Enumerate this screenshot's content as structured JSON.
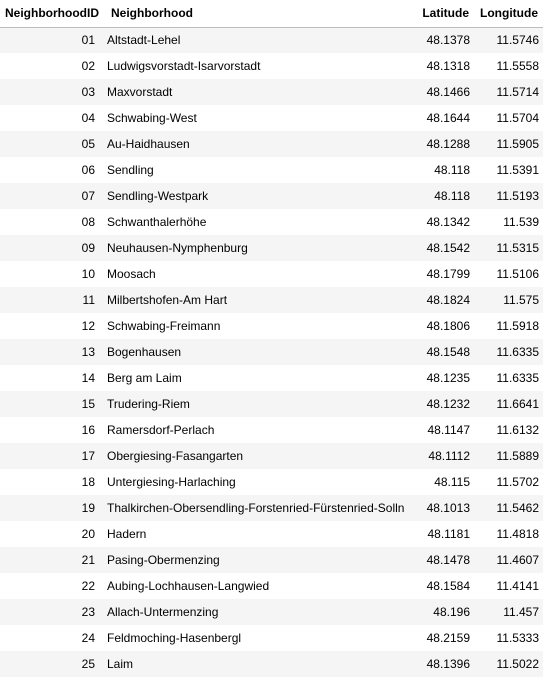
{
  "table": {
    "columns": [
      "NeighborhoodID",
      "Neighborhood",
      "Latitude",
      "Longitude"
    ],
    "rows": [
      [
        "01",
        "Altstadt-Lehel",
        "48.1378",
        "11.5746"
      ],
      [
        "02",
        "Ludwigsvorstadt-Isarvorstadt",
        "48.1318",
        "11.5558"
      ],
      [
        "03",
        "Maxvorstadt",
        "48.1466",
        "11.5714"
      ],
      [
        "04",
        "Schwabing-West",
        "48.1644",
        "11.5704"
      ],
      [
        "05",
        "Au-Haidhausen",
        "48.1288",
        "11.5905"
      ],
      [
        "06",
        "Sendling",
        "48.118",
        "11.5391"
      ],
      [
        "07",
        "Sendling-Westpark",
        "48.118",
        "11.5193"
      ],
      [
        "08",
        "Schwanthalerhöhe",
        "48.1342",
        "11.539"
      ],
      [
        "09",
        "Neuhausen-Nymphenburg",
        "48.1542",
        "11.5315"
      ],
      [
        "10",
        "Moosach",
        "48.1799",
        "11.5106"
      ],
      [
        "11",
        "Milbertshofen-Am Hart",
        "48.1824",
        "11.575"
      ],
      [
        "12",
        "Schwabing-Freimann",
        "48.1806",
        "11.5918"
      ],
      [
        "13",
        "Bogenhausen",
        "48.1548",
        "11.6335"
      ],
      [
        "14",
        "Berg am Laim",
        "48.1235",
        "11.6335"
      ],
      [
        "15",
        "Trudering-Riem",
        "48.1232",
        "11.6641"
      ],
      [
        "16",
        "Ramersdorf-Perlach",
        "48.1147",
        "11.6132"
      ],
      [
        "17",
        "Obergiesing-Fasangarten",
        "48.1112",
        "11.5889"
      ],
      [
        "18",
        "Untergiesing-Harlaching",
        "48.115",
        "11.5702"
      ],
      [
        "19",
        "Thalkirchen-Obersendling-Forstenried-Fürstenried-Solln",
        "48.1013",
        "11.5462"
      ],
      [
        "20",
        "Hadern",
        "48.1181",
        "11.4818"
      ],
      [
        "21",
        "Pasing-Obermenzing",
        "48.1478",
        "11.4607"
      ],
      [
        "22",
        "Aubing-Lochhausen-Langwied",
        "48.1584",
        "11.4141"
      ],
      [
        "23",
        "Allach-Untermenzing",
        "48.196",
        "11.457"
      ],
      [
        "24",
        "Feldmoching-Hasenbergl",
        "48.2159",
        "11.5333"
      ],
      [
        "25",
        "Laim",
        "48.1396",
        "11.5022"
      ]
    ]
  }
}
